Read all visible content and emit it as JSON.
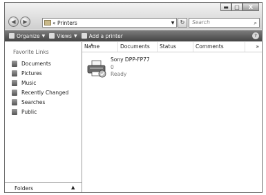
{
  "window": {
    "controls": {
      "minimize": "▬",
      "maximize": "□",
      "close": "X"
    }
  },
  "nav": {
    "back": "◀",
    "forward": "▶"
  },
  "address": {
    "path": "« Printers",
    "dropdown": "▼",
    "refresh": "↻"
  },
  "search": {
    "placeholder": "Search",
    "icon": "⌕"
  },
  "toolbar": {
    "organize": "Organize",
    "views": "Views",
    "add_printer": "Add a printer",
    "help": "?"
  },
  "sidebar": {
    "title": "Favorite Links",
    "items": [
      {
        "label": "Documents",
        "icon": "documents-icon"
      },
      {
        "label": "Pictures",
        "icon": "pictures-icon"
      },
      {
        "label": "Music",
        "icon": "music-icon"
      },
      {
        "label": "Recently Changed",
        "icon": "recent-icon"
      },
      {
        "label": "Searches",
        "icon": "searches-icon"
      },
      {
        "label": "Public",
        "icon": "public-icon"
      }
    ],
    "folders_label": "Folders",
    "folders_chevron": "▲"
  },
  "columns": [
    "Name",
    "Documents",
    "Status",
    "Comments"
  ],
  "columns_more": "»",
  "printer": {
    "name": "Sony DPP-FP77",
    "documents": "0",
    "status": "Ready"
  }
}
